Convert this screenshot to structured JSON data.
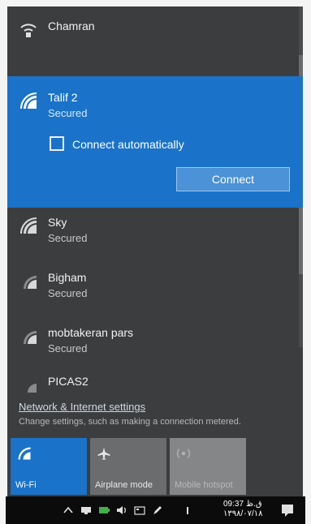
{
  "networks": {
    "top": {
      "name": "Chamran",
      "icon": "wifi-lock-icon"
    },
    "selected": {
      "name": "Talif 2",
      "status": "Secured",
      "connect_auto_label": "Connect automatically",
      "connect_auto_checked": false,
      "connect_button": "Connect",
      "icon": "wifi-signal-icon"
    },
    "list": [
      {
        "name": "Sky",
        "status": "Secured",
        "icon": "wifi-signal-icon"
      },
      {
        "name": "Bigham",
        "status": "Secured",
        "icon": "wifi-signal-icon"
      },
      {
        "name": "mobtakeran pars",
        "status": "Secured",
        "icon": "wifi-signal-icon"
      },
      {
        "name": "PICAS2",
        "status": "",
        "icon": "wifi-signal-icon"
      }
    ]
  },
  "settings": {
    "link": "Network & Internet settings",
    "description": "Change settings, such as making a connection metered."
  },
  "quick_actions": [
    {
      "label": "Wi-Fi",
      "icon": "wifi-icon",
      "active": true
    },
    {
      "label": "Airplane mode",
      "icon": "airplane-icon",
      "active": false
    },
    {
      "label": "Mobile hotspot",
      "icon": "hotspot-icon",
      "active": false
    }
  ],
  "taskbar": {
    "time": "09:37",
    "ampm": "ق.ظ",
    "date": "۱۳۹۸/۰۷/۱۸",
    "icons": [
      "chevron-up-icon",
      "network-icon",
      "battery-icon",
      "volume-icon",
      "keyboard-icon",
      "pen-icon",
      "language-icon",
      "notification-icon"
    ]
  },
  "colors": {
    "panel": "#3c3d3f",
    "accent": "#1a73c9",
    "tile_inactive": "#6b6c6e",
    "taskbar": "#0b0b0c"
  }
}
